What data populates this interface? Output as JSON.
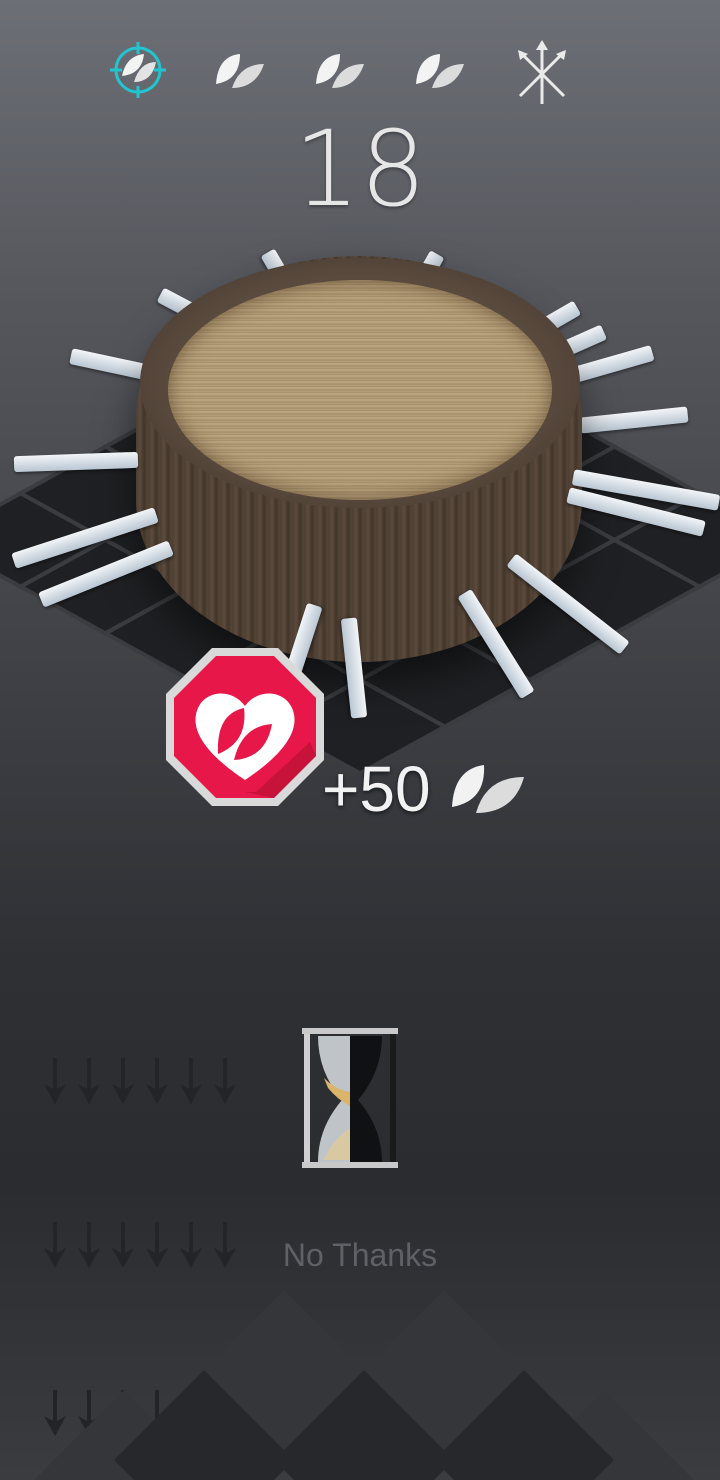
{
  "stages": [
    {
      "icon": "leaf-target-icon",
      "state": "current"
    },
    {
      "icon": "leaf-icon",
      "state": "upcoming"
    },
    {
      "icon": "leaf-icon",
      "state": "upcoming"
    },
    {
      "icon": "leaf-icon",
      "state": "upcoming"
    },
    {
      "icon": "crossed-arrows-icon",
      "state": "boss"
    }
  ],
  "score": "18",
  "bonus": {
    "text": "+50",
    "icon": "leaf-icon"
  },
  "heart_badge_icon": "heart-leaf-icon",
  "continue_timer_icon": "hourglass-icon",
  "no_thanks_label": "No Thanks",
  "colors": {
    "accent": "#21c4cf",
    "badge": "#e8174a",
    "text": "#e6e6e6"
  }
}
